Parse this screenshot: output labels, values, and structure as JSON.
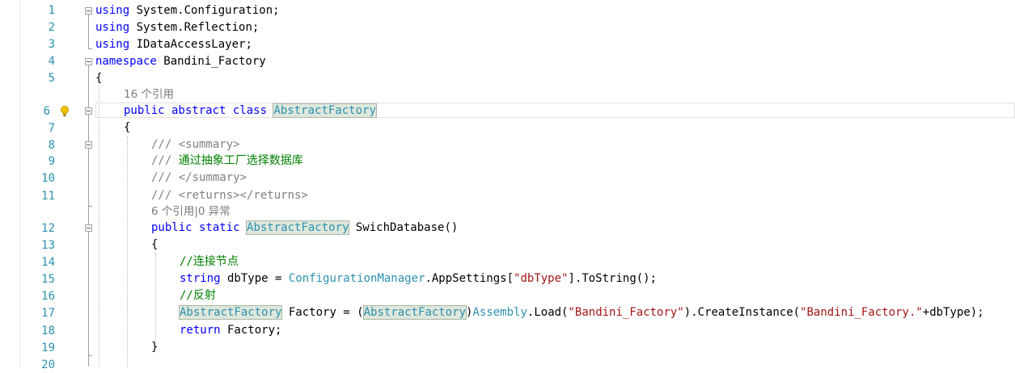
{
  "editor": {
    "line_numbers": [
      "1",
      "2",
      "3",
      "4",
      "5",
      "6",
      "7",
      "8",
      "9",
      "10",
      "11",
      "12",
      "13",
      "14",
      "15",
      "16",
      "17",
      "18",
      "19",
      "20"
    ],
    "lines": {
      "l1": {
        "kw": "using",
        "rest": " System.Configuration;"
      },
      "l2": {
        "kw": "using",
        "rest": " System.Reflection;"
      },
      "l3": {
        "kw": "using",
        "rest": " IDataAccessLayer;"
      },
      "l4": {
        "kw": "namespace",
        "rest": " Bandini_Factory"
      },
      "l5": {
        "text": "{"
      },
      "l6": {
        "kw": "public abstract class",
        "sp": " ",
        "type": "AbstractFactory"
      },
      "l7": {
        "text": "{"
      },
      "l8": {
        "doc": "/// <summary>"
      },
      "l9": {
        "slashes": "///",
        "comment": " 通过抽象工厂选择数据库"
      },
      "l10": {
        "doc": "/// </summary>"
      },
      "l11": {
        "doc": "/// <returns></returns>"
      },
      "l12": {
        "kw": "public static",
        "sp": " ",
        "type": "AbstractFactory",
        "rest": " SwichDatabase()"
      },
      "l13": {
        "text": "{"
      },
      "l14": {
        "comment": "//连接节点"
      },
      "l15": {
        "kw": "string",
        "a": " dbType = ",
        "type": "ConfigurationManager",
        "b": ".AppSettings[",
        "str": "\"dbType\"",
        "c": "].ToString();"
      },
      "l16": {
        "comment": "//反射"
      },
      "l17": {
        "type1": "AbstractFactory",
        "a": " Factory = (",
        "type2": "AbstractFactory",
        "b": ")",
        "type3": "Assembly",
        "c": ".Load(",
        "str1": "\"Bandini_Factory\"",
        "d": ").CreateInstance(",
        "str2": "\"Bandini_Factory.\"",
        "e": "+dbType);"
      },
      "l18": {
        "kw": "return",
        "rest": " Factory;"
      },
      "l19": {
        "text": "}"
      }
    },
    "code_lens": {
      "class_refs": "16 个引用",
      "method_refs": "6 个引用|0 异常"
    },
    "colors": {
      "keyword": "#0000ff",
      "type": "#2b91af",
      "comment": "#008000",
      "doc_comment": "#808080",
      "string": "#a31515",
      "line_number": "#2b91af",
      "highlight": "#dfe7dc"
    },
    "icons": [
      "lightbulb-icon",
      "collapse-icon"
    ]
  }
}
